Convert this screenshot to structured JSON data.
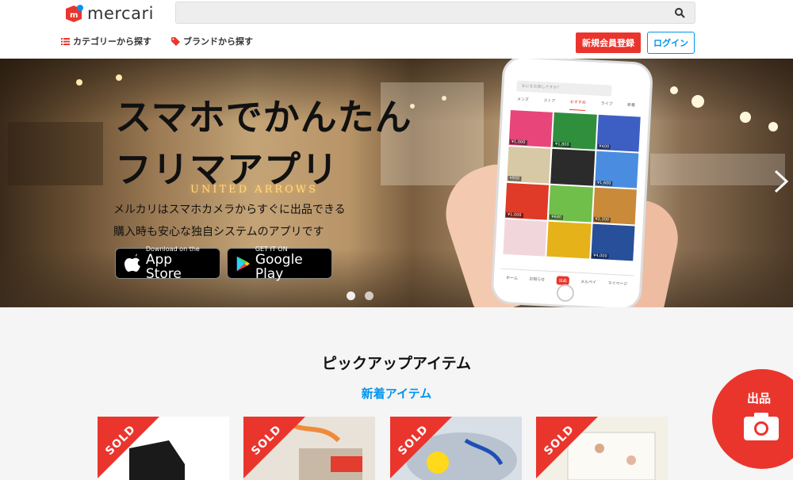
{
  "header": {
    "logo_text": "mercari",
    "search_placeholder": "",
    "nav": {
      "category": "カテゴリーから探す",
      "brand": "ブランドから探す"
    },
    "signup": "新規会員登録",
    "login": "ログイン"
  },
  "hero": {
    "title_line1": "スマホでかんたん",
    "title_line2": "フリマアプリ",
    "sub_line1": "メルカリはスマホカメラからすぐに出品できる",
    "sub_line2": "購入時も安心な独自システムのアプリです",
    "store_sign": "UNITED ARROWS",
    "app_store": {
      "small": "Download on the",
      "big": "App Store"
    },
    "google_play": {
      "small": "GET IT ON",
      "big": "Google Play"
    },
    "phone": {
      "search_placeholder": "なにをお探しですか？",
      "tabs": [
        "メンズ",
        "ストア",
        "おすすめ",
        "ライブ",
        "新着"
      ],
      "active_tab": "おすすめ",
      "prices": [
        "¥1,000",
        "¥1,800",
        "¥400",
        "¥900",
        "",
        "¥1,600",
        "¥1,000",
        "¥680",
        "¥2,300",
        "",
        "",
        "¥4,000"
      ],
      "bottom_nav": [
        "ホーム",
        "お知らせ",
        "出品",
        "メルペイ",
        "マイページ"
      ]
    }
  },
  "pickup": {
    "title": "ピックアップアイテム",
    "subtitle": "新着アイテム"
  },
  "items": [
    {
      "sold_label": "SOLD"
    },
    {
      "sold_label": "SOLD"
    },
    {
      "sold_label": "SOLD"
    },
    {
      "sold_label": "SOLD"
    }
  ],
  "sell_button": {
    "label": "出品"
  },
  "colors": {
    "brand_red": "#ea352d",
    "link_blue": "#0095ee"
  }
}
